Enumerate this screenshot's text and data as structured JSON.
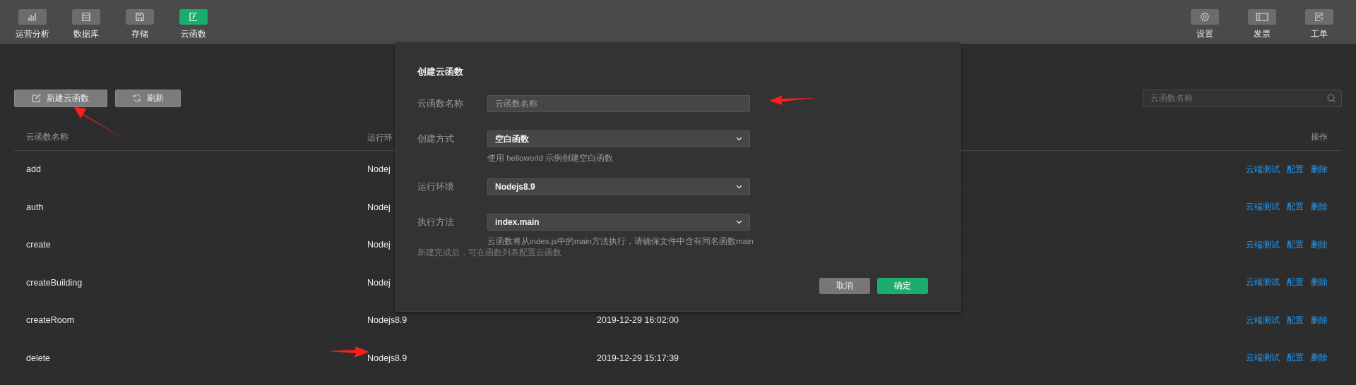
{
  "nav": {
    "left": [
      {
        "label": "运营分析",
        "selected": false
      },
      {
        "label": "数据库",
        "selected": false
      },
      {
        "label": "存储",
        "selected": false
      },
      {
        "label": "云函数",
        "selected": true
      }
    ],
    "right": [
      {
        "label": "设置",
        "selected": false
      },
      {
        "label": "发票",
        "selected": false
      },
      {
        "label": "工单",
        "selected": false
      }
    ]
  },
  "toolbar": {
    "buttons": [
      "新建云函数",
      "刷新"
    ],
    "search": {
      "placeholder": "云函数名称"
    }
  },
  "table": {
    "columns": [
      "云函数名称",
      "运行环",
      "操作"
    ],
    "rows": [
      {
        "name": "add",
        "runtime": "Nodej",
        "actions": [
          "云端测试",
          "配置",
          "删除"
        ]
      },
      {
        "name": "auth",
        "runtime": "Nodej",
        "actions": [
          "云端测试",
          "配置",
          "删除"
        ]
      },
      {
        "name": "create",
        "runtime": "Nodej",
        "actions": [
          "云端测试",
          "配置",
          "删除"
        ]
      },
      {
        "name": "createBuilding",
        "runtime": "Nodej",
        "actions": [
          "云端测试",
          "配置",
          "删除"
        ]
      },
      {
        "name": "createRoom",
        "runtime": "Nodejs8.9",
        "created": "2019-12-29 16:02:00",
        "actions": [
          "云端测试",
          "配置",
          "删除"
        ]
      },
      {
        "name": "delete",
        "runtime": "Nodejs8.9",
        "created": "2019-12-29 15:17:39",
        "actions": [
          "云端测试",
          "配置",
          "删除"
        ]
      }
    ]
  },
  "dialog": {
    "title": "创建云函数",
    "fields": [
      {
        "kind": "input",
        "label": "云函数名称",
        "placeholder": "云函数名称"
      },
      {
        "kind": "select",
        "label": "创建方式",
        "value": "空白函数",
        "hint": "使用 helloworld 示例创建空白函数"
      },
      {
        "kind": "select",
        "label": "运行环境",
        "value": "Nodejs8.9"
      },
      {
        "kind": "select",
        "label": "执行方法",
        "value": "index.main",
        "hint": "云函数将从index.js中的main方法执行，请确保文件中含有同名函数main"
      }
    ],
    "note": "新建完成后，可在函数列表配置云函数",
    "buttons": [
      {
        "kind": "secondary",
        "label": "取消"
      },
      {
        "kind": "primary",
        "label": "确定"
      }
    ]
  }
}
